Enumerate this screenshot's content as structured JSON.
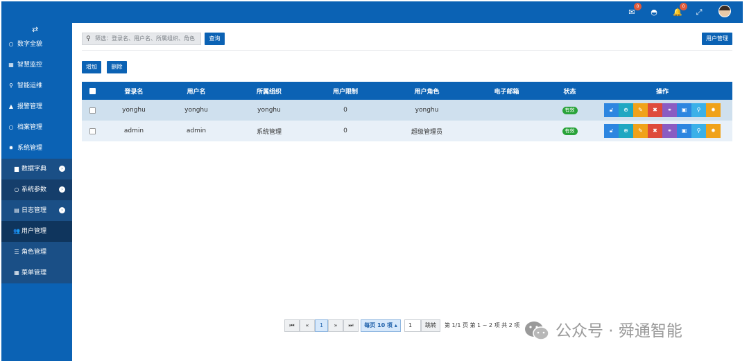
{
  "topbar": {
    "mail_badge": "0",
    "bell_badge": "0",
    "icons": [
      "mail-icon",
      "dashboard-icon",
      "bell-icon",
      "fullscreen-icon",
      "avatar"
    ]
  },
  "sidebar": {
    "toggle_icon": "⇄",
    "items": [
      {
        "label": "数字全貌",
        "icon": "circle-icon"
      },
      {
        "label": "智慧监控",
        "icon": "grid-icon"
      },
      {
        "label": "智能运维",
        "icon": "sitemap-icon"
      },
      {
        "label": "报警管理",
        "icon": "bell-icon"
      },
      {
        "label": "档案管理",
        "icon": "circle-icon"
      },
      {
        "label": "系统管理",
        "icon": "gear-icon"
      }
    ],
    "sub_items": [
      {
        "label": "数据字典",
        "icon": "book-icon",
        "expandable": true
      },
      {
        "label": "系统参数",
        "icon": "circle-icon",
        "expandable": true
      },
      {
        "label": "日志管理",
        "icon": "calendar-icon",
        "expandable": true
      },
      {
        "label": "用户管理",
        "icon": "users-icon",
        "active": true
      },
      {
        "label": "角色管理",
        "icon": "list-icon"
      },
      {
        "label": "菜单管理",
        "icon": "grid-icon"
      }
    ]
  },
  "toolbar": {
    "search_placeholder": "筛选：登录名、用户名、所属组织、角色",
    "query_label": "查询",
    "page_title": "用户管理",
    "add_label": "增加",
    "delete_label": "删除"
  },
  "table": {
    "headers": [
      "登录名",
      "用户名",
      "所属组织",
      "用户限制",
      "用户角色",
      "电子邮箱",
      "状态",
      "操作"
    ],
    "rows": [
      {
        "login": "yonghu",
        "name": "yonghu",
        "org": "yonghu",
        "limit": "0",
        "role": "yonghu",
        "email": "",
        "status": "有效"
      },
      {
        "login": "admin",
        "name": "admin",
        "org": "系统管理",
        "limit": "0",
        "role": "超级管理员",
        "email": "",
        "status": "有效"
      }
    ],
    "actions": [
      {
        "icon": "unlock-icon",
        "color": "#2d86e0"
      },
      {
        "icon": "zoom-icon",
        "color": "#1fa7c2"
      },
      {
        "icon": "edit-icon",
        "color": "#f0a21a"
      },
      {
        "icon": "close-circle-icon",
        "color": "#de4b3b"
      },
      {
        "icon": "share-icon",
        "color": "#8a5cc2"
      },
      {
        "icon": "image-icon",
        "color": "#2d86e0"
      },
      {
        "icon": "sitemap-icon",
        "color": "#3bb0e8"
      },
      {
        "icon": "gear-icon",
        "color": "#f0a21a"
      }
    ]
  },
  "pagination": {
    "first": "⏮",
    "prev": "«",
    "current_page": "1",
    "next": "»",
    "last": "⏭",
    "page_size_label": "每页 10 项 ▴",
    "jump_value": "1",
    "jump_label": "跳转",
    "info_page": "第 1/1 页",
    "info_range": "第 1 ~ 2 项",
    "info_total": "共 2 项"
  },
  "watermark": {
    "text": "公众号 · 舜通智能"
  }
}
